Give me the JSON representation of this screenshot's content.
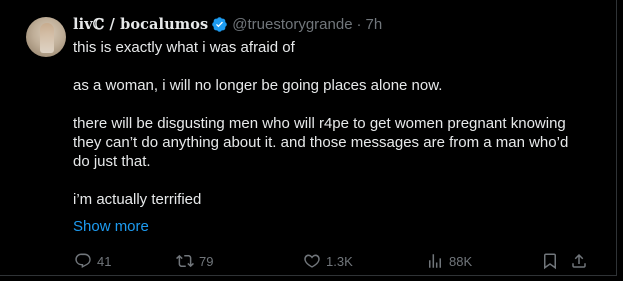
{
  "tweet": {
    "display_name": "livℂ / bocalumos",
    "handle": "@truestorygrande",
    "separator": "·",
    "time": "7h",
    "lines": [
      "this is exactly what i was afraid of",
      "",
      "as a woman, i will no longer be going places alone now.",
      "",
      "there will be disgusting men who will r4pe to get women pregnant knowing they can’t do anything about it. and those messages are from a man who’d do just that.",
      "",
      "i’m actually terrified"
    ],
    "show_more": "Show more"
  },
  "actions": {
    "replies": "41",
    "reposts": "79",
    "likes": "1.3K",
    "views": "88K"
  },
  "icons": {
    "verified": "verified-badge-icon",
    "reply": "reply-icon",
    "repost": "repost-icon",
    "like": "heart-icon",
    "views": "views-icon",
    "bookmark": "bookmark-icon",
    "share": "share-icon"
  },
  "colors": {
    "background": "#000000",
    "text": "#e7e9ea",
    "muted": "#71767b",
    "link": "#1d9bf0",
    "border": "#2f3336"
  }
}
